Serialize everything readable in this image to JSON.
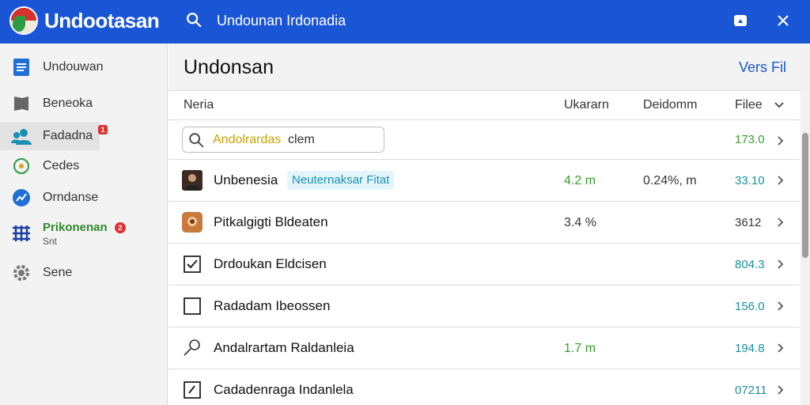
{
  "header": {
    "app_title": "Undootasan",
    "search_text": "Undounan Irdonadia"
  },
  "sidebar": {
    "items": [
      {
        "label": "Undouwan",
        "icon": "document-icon"
      },
      {
        "label": "Beneoka",
        "icon": "bookmark-icon"
      },
      {
        "label": "Fadadna",
        "icon": "people-icon",
        "badge": "1"
      },
      {
        "label": "Cedes",
        "icon": "target-icon"
      },
      {
        "label": "Orndanse",
        "icon": "chart-icon"
      },
      {
        "label": "Prikonenan",
        "sublabel": "Snt",
        "icon": "grid-icon",
        "badge": "2"
      },
      {
        "label": "Sene",
        "icon": "gear-icon"
      }
    ]
  },
  "main": {
    "title": "Undonsan",
    "link": "Vers Fil",
    "columns": [
      "Neria",
      "Ukararn",
      "Deidomm",
      "Filee"
    ],
    "filter": {
      "highlight": "Andolrardas",
      "rest": "clem",
      "value": "173.0"
    },
    "rows": [
      {
        "name": "Unbenesia",
        "tag": "Neuternaksar Fitat",
        "c2": "4.2 m",
        "c3": "0.24%, m",
        "c4": "33.10",
        "icon": "avatar-icon"
      },
      {
        "name": "Pitkalgigti Bldeaten",
        "tag": "",
        "c2": "3.4 %",
        "c3": "",
        "c4": "3612",
        "icon": "contact-icon"
      },
      {
        "name": "Drdoukan Eldcisen",
        "tag": "",
        "c2": "",
        "c3": "",
        "c4": "804.3",
        "icon": "checkbox-checked-icon"
      },
      {
        "name": "Radadam Ibeossen",
        "tag": "",
        "c2": "",
        "c3": "",
        "c4": "156.0",
        "icon": "checkbox-icon"
      },
      {
        "name": "Andalrartam Raldanleia",
        "tag": "",
        "c2": "1.7 m",
        "c3": "",
        "c4": "194.8",
        "icon": "key-icon"
      },
      {
        "name": "Cadadenraga Indanlela",
        "tag": "",
        "c2": "",
        "c3": "",
        "c4": "07211",
        "icon": "edit-box-icon"
      }
    ]
  },
  "colors": {
    "topbar": "#1a55d6",
    "sidebar_bg": "#f3f3f3",
    "accent_link": "#1a55d6",
    "green_value": "#3a9a2e",
    "teal_value": "#1a8f9c",
    "badge": "#e03232"
  }
}
